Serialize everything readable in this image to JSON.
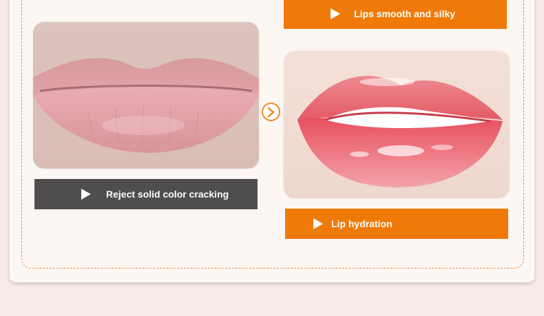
{
  "labels": {
    "top": "Lips smooth and silky",
    "left": "Reject solid color cracking",
    "bottom": "Lip hydration"
  },
  "icons": {
    "play": "play-icon",
    "arrow": "arrow-right-circle-icon"
  },
  "colors": {
    "accent_orange": "#ef7a0a",
    "dark_gray": "#4f4d4d",
    "background": "#f8ebe5"
  }
}
